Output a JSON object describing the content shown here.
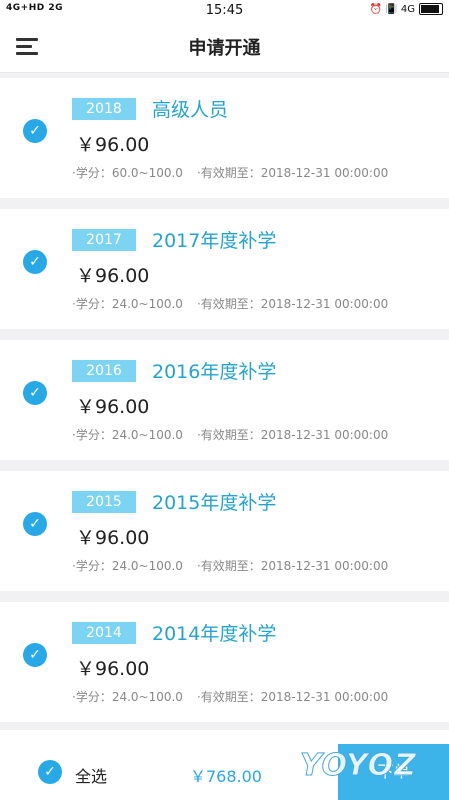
{
  "status_bar": {
    "signal_text": "4G+HD 2G",
    "time": "15:45",
    "right_text": "⏰ 📳 4G"
  },
  "nav": {
    "title": "申请开通",
    "menu_icon": "menu-icon"
  },
  "items": [
    {
      "badge": "2018",
      "title": "高级人员",
      "price": "￥96.00",
      "credit": "·学分：60.0~100.0",
      "expiry": "·有效期至：2018-12-31 00:00:00",
      "checked": true
    },
    {
      "badge": "2017",
      "title": "2017年度补学",
      "price": "￥96.00",
      "credit": "·学分：24.0~100.0",
      "expiry": "·有效期至：2018-12-31 00:00:00",
      "checked": true
    },
    {
      "badge": "2016",
      "title": "2016年度补学",
      "price": "￥96.00",
      "credit": "·学分：24.0~100.0",
      "expiry": "·有效期至：2018-12-31 00:00:00",
      "checked": true
    },
    {
      "badge": "2015",
      "title": "2015年度补学",
      "price": "￥96.00",
      "credit": "·学分：24.0~100.0",
      "expiry": "·有效期至：2018-12-31 00:00:00",
      "checked": true
    },
    {
      "badge": "2014",
      "title": "2014年度补学",
      "price": "￥96.00",
      "credit": "·学分：24.0~100.0",
      "expiry": "·有效期至：2018-12-31 00:00:00",
      "checked": true
    }
  ],
  "footer": {
    "select_all_label": "全选",
    "total": "￥768.00",
    "order_label": "下单"
  },
  "watermark": "YOYOZ",
  "colors": {
    "accent": "#29a8e6",
    "badge": "#7dd3f2",
    "title": "#26a3cc"
  }
}
